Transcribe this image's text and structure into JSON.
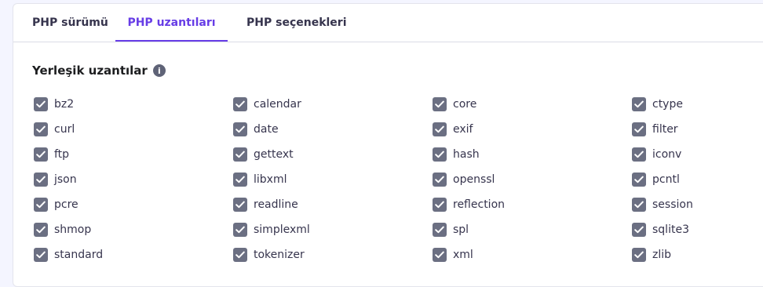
{
  "tabs": [
    {
      "label": "PHP sürümü"
    },
    {
      "label": "PHP uzantıları"
    },
    {
      "label": "PHP seçenekleri"
    }
  ],
  "active_tab": "PHP uzantıları",
  "section": {
    "title": "Yerleşik uzantılar",
    "info_icon": "info-icon"
  },
  "extensions": [
    "bz2",
    "calendar",
    "core",
    "ctype",
    "curl",
    "date",
    "exif",
    "filter",
    "ftp",
    "gettext",
    "hash",
    "iconv",
    "json",
    "libxml",
    "openssl",
    "pcntl",
    "pcre",
    "readline",
    "reflection",
    "session",
    "shmop",
    "simplexml",
    "spl",
    "sqlite3",
    "standard",
    "tokenizer",
    "xml",
    "zlib"
  ],
  "colors": {
    "accent": "#673de6",
    "checkbox": "#6b6f82",
    "text": "#36344d"
  }
}
